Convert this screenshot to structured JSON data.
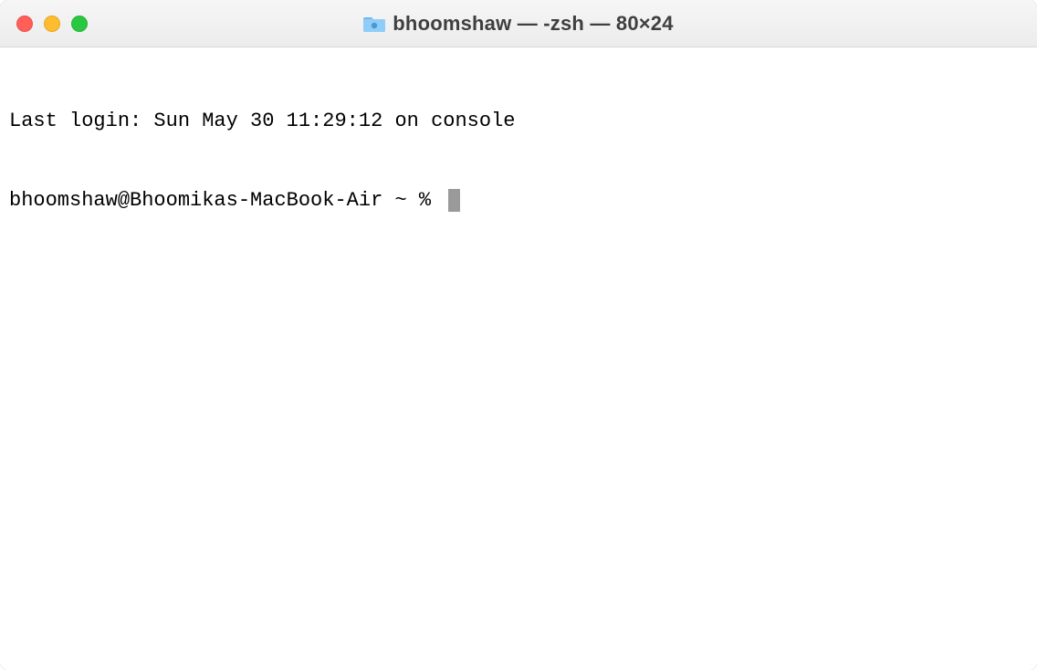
{
  "window": {
    "title": "bhoomshaw — -zsh — 80×24"
  },
  "terminal": {
    "last_login_line": "Last login: Sun May 30 11:29:12 on console",
    "prompt": "bhoomshaw@Bhoomikas-MacBook-Air ~ % "
  },
  "colors": {
    "close": "#ff5f57",
    "minimize": "#febc2e",
    "zoom": "#28c840",
    "titlebar_bg_top": "#f6f6f6",
    "titlebar_bg_bottom": "#ececec",
    "cursor": "#9a9a9a"
  }
}
